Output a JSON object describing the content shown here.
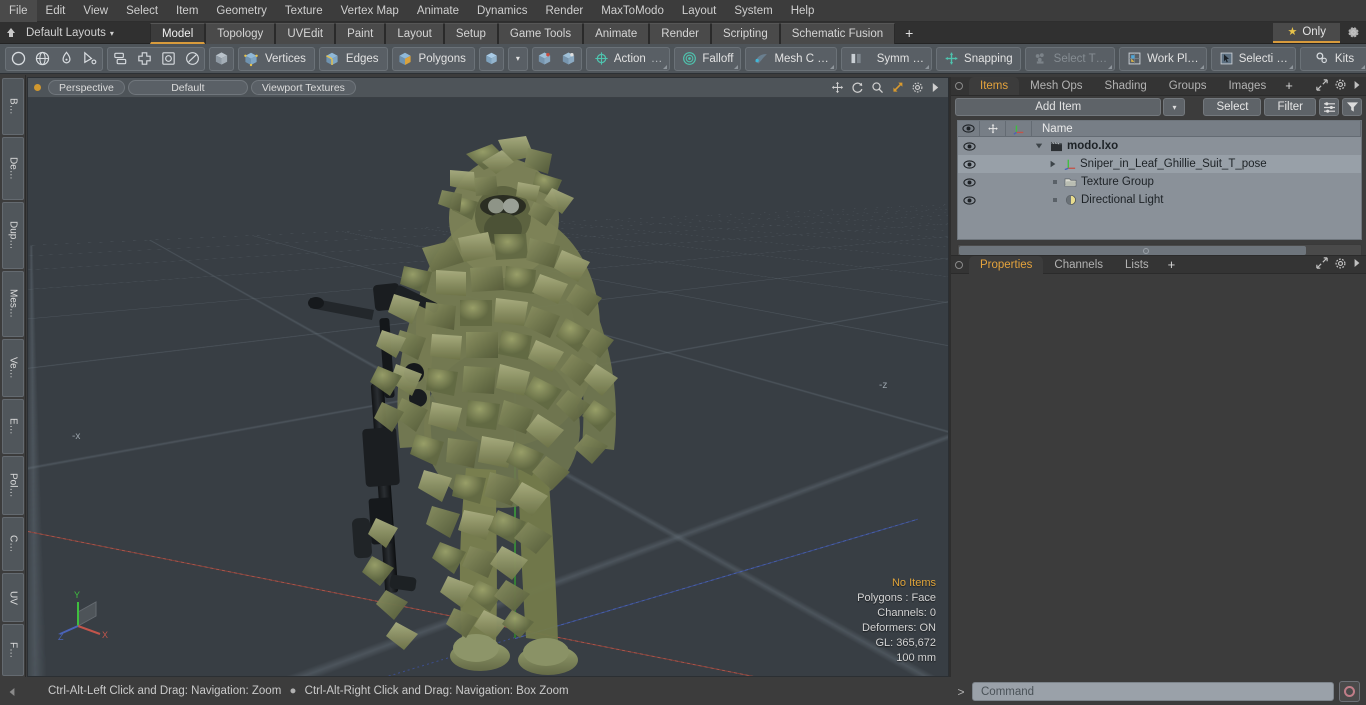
{
  "app": {
    "title": "modo"
  },
  "menubar": {
    "items": [
      "File",
      "Edit",
      "View",
      "Select",
      "Item",
      "Geometry",
      "Texture",
      "Vertex Map",
      "Animate",
      "Dynamics",
      "Render",
      "MaxToModo",
      "Layout",
      "System",
      "Help"
    ]
  },
  "layoutbar": {
    "home_icon": "home-icon",
    "layouts_label": "Default Layouts",
    "layouts_caret": "▾",
    "tabs": [
      {
        "label": "Model",
        "active": true
      },
      {
        "label": "Topology",
        "active": false
      },
      {
        "label": "UVEdit",
        "active": false
      },
      {
        "label": "Paint",
        "active": false
      },
      {
        "label": "Layout",
        "active": false
      },
      {
        "label": "Setup",
        "active": false
      },
      {
        "label": "Game Tools",
        "active": false
      },
      {
        "label": "Animate",
        "active": false
      },
      {
        "label": "Render",
        "active": false
      },
      {
        "label": "Scripting",
        "active": false
      },
      {
        "label": "Schematic Fusion",
        "active": false
      }
    ],
    "add_tab": "+",
    "only_label": "Only",
    "only_star": "★",
    "gear_icon": "gear-icon",
    "active_accent": "#d89b3c"
  },
  "toolbar": {
    "shape_icons": [
      "circle-icon",
      "globe-icon",
      "pen-icon",
      "curve-icon"
    ],
    "transform_icons": [
      "mirror-icon",
      "move-icon",
      "center-icon",
      "radial-icon"
    ],
    "item_mode_icon": "cube-icon",
    "selection_modes": [
      {
        "label": "Vertices",
        "icon": "vertices-cube-icon"
      },
      {
        "label": "Edges",
        "icon": "edges-cube-icon"
      },
      {
        "label": "Polygons",
        "icon": "polygons-cube-icon"
      }
    ],
    "mode_dropdown_caret": "▾",
    "snap_icons": [
      "snap-vertex-icon",
      "snap-element-icon"
    ],
    "buttons": [
      {
        "label": "Action",
        "suffix": "…",
        "icon": "action-center-icon",
        "dim": false
      },
      {
        "label": "Falloff",
        "suffix": "",
        "icon": "falloff-icon",
        "dim": false
      },
      {
        "label": "Mesh C …",
        "suffix": "",
        "icon": "mesh-constraint-icon",
        "dim": false
      },
      {
        "label": "Symm …",
        "suffix": "",
        "icon": "symmetry-icon",
        "dim": false
      },
      {
        "label": "Snapping",
        "suffix": "",
        "icon": "snapping-icon",
        "dim": false
      },
      {
        "label": "Select T…",
        "suffix": "",
        "icon": "select-through-icon",
        "dim": true
      },
      {
        "label": "Work Pl…",
        "suffix": "",
        "icon": "work-plane-icon",
        "dim": false
      },
      {
        "label": "Selecti …",
        "suffix": "",
        "icon": "selection-set-icon",
        "dim": false
      },
      {
        "label": "Kits",
        "suffix": "",
        "icon": "kits-gear-icon",
        "dim": false
      }
    ],
    "right_icons": [
      "modo-bridge-icon",
      "unreal-icon"
    ]
  },
  "left_strip": {
    "tabs": [
      "B…",
      "De…",
      "Dup…",
      "Mes…",
      "Ve…",
      "E…",
      "Pol…",
      "C…",
      "UV",
      "F…"
    ]
  },
  "viewport": {
    "header": {
      "dot": "active-view-dot",
      "pills": [
        "Perspective",
        "Default",
        "Viewport Textures"
      ],
      "right_icons": [
        "pan-icon",
        "rotate-icon",
        "zoom-icon",
        "fit-icon",
        "viewport-gear-icon",
        "chevron-right-icon"
      ]
    },
    "gizmo": {
      "x": "X",
      "y": "Y",
      "z": "Z",
      "x_color": "#c2554b",
      "y_color": "#49a849",
      "z_color": "#4a63b8"
    },
    "stats": {
      "selection": "No Items",
      "polygons": "Polygons : Face",
      "channels": "Channels: 0",
      "deformers": "Deformers: ON",
      "gl": "GL: 365,672",
      "units": "100 mm"
    },
    "background_color": "#383e44",
    "grid_color": "#6c7882",
    "model_name": "Sniper in Leaf Ghillie Suit"
  },
  "right_panel": {
    "top_tabs": [
      {
        "label": "Items",
        "active": true
      },
      {
        "label": "Mesh Ops",
        "active": false
      },
      {
        "label": "Shading",
        "active": false
      },
      {
        "label": "Groups",
        "active": false
      },
      {
        "label": "Images",
        "active": false
      }
    ],
    "top_tabs_plus": "+",
    "top_tabs_right_icons": [
      "expand-icon",
      "gear-icon",
      "chevron-right-icon"
    ],
    "add_item_label": "Add Item",
    "add_item_caret": "▾",
    "select_label": "Select",
    "filter_label": "Filter",
    "list_options_icon": "list-options-icon",
    "filter_funnel_icon": "funnel-icon",
    "list_header": {
      "eye_icon": "eye-icon",
      "lock_icon": "move-lock-icon",
      "axis_icon": "axis-icon",
      "name": "Name"
    },
    "items": [
      {
        "name": "modo.lxo",
        "icon": "scene-icon",
        "depth": 0,
        "expanded": true,
        "bold": true,
        "eye": true,
        "selected": false
      },
      {
        "name": "Sniper_in_Leaf_Ghillie_Suit_T_pose",
        "icon": "mesh-axis-icon",
        "depth": 1,
        "expanded": false,
        "bold": false,
        "eye": true,
        "selected": true
      },
      {
        "name": "Texture Group",
        "icon": "folder-icon",
        "depth": 1,
        "expanded": null,
        "bold": false,
        "eye": true,
        "selected": false
      },
      {
        "name": "Directional Light",
        "icon": "light-icon",
        "depth": 1,
        "expanded": null,
        "bold": false,
        "eye": true,
        "selected": false
      }
    ],
    "bottom_tabs": [
      {
        "label": "Properties",
        "active": true
      },
      {
        "label": "Channels",
        "active": false
      },
      {
        "label": "Lists",
        "active": false
      }
    ],
    "bottom_tabs_plus": "+",
    "bottom_tabs_right_icons": [
      "expand-icon",
      "gear-icon",
      "chevron-right-icon"
    ],
    "accent_color": "#e4a33d"
  },
  "statusbar": {
    "left_arrow": "◀",
    "hint_a": "Ctrl-Alt-Left Click and Drag: Navigation: Zoom",
    "hint_sep": "●",
    "hint_b": "Ctrl-Alt-Right Click and Drag: Navigation: Box Zoom"
  },
  "command_bar": {
    "prompt": "&gt;",
    "placeholder": "Command",
    "value": "",
    "record_icon": "record-icon"
  }
}
